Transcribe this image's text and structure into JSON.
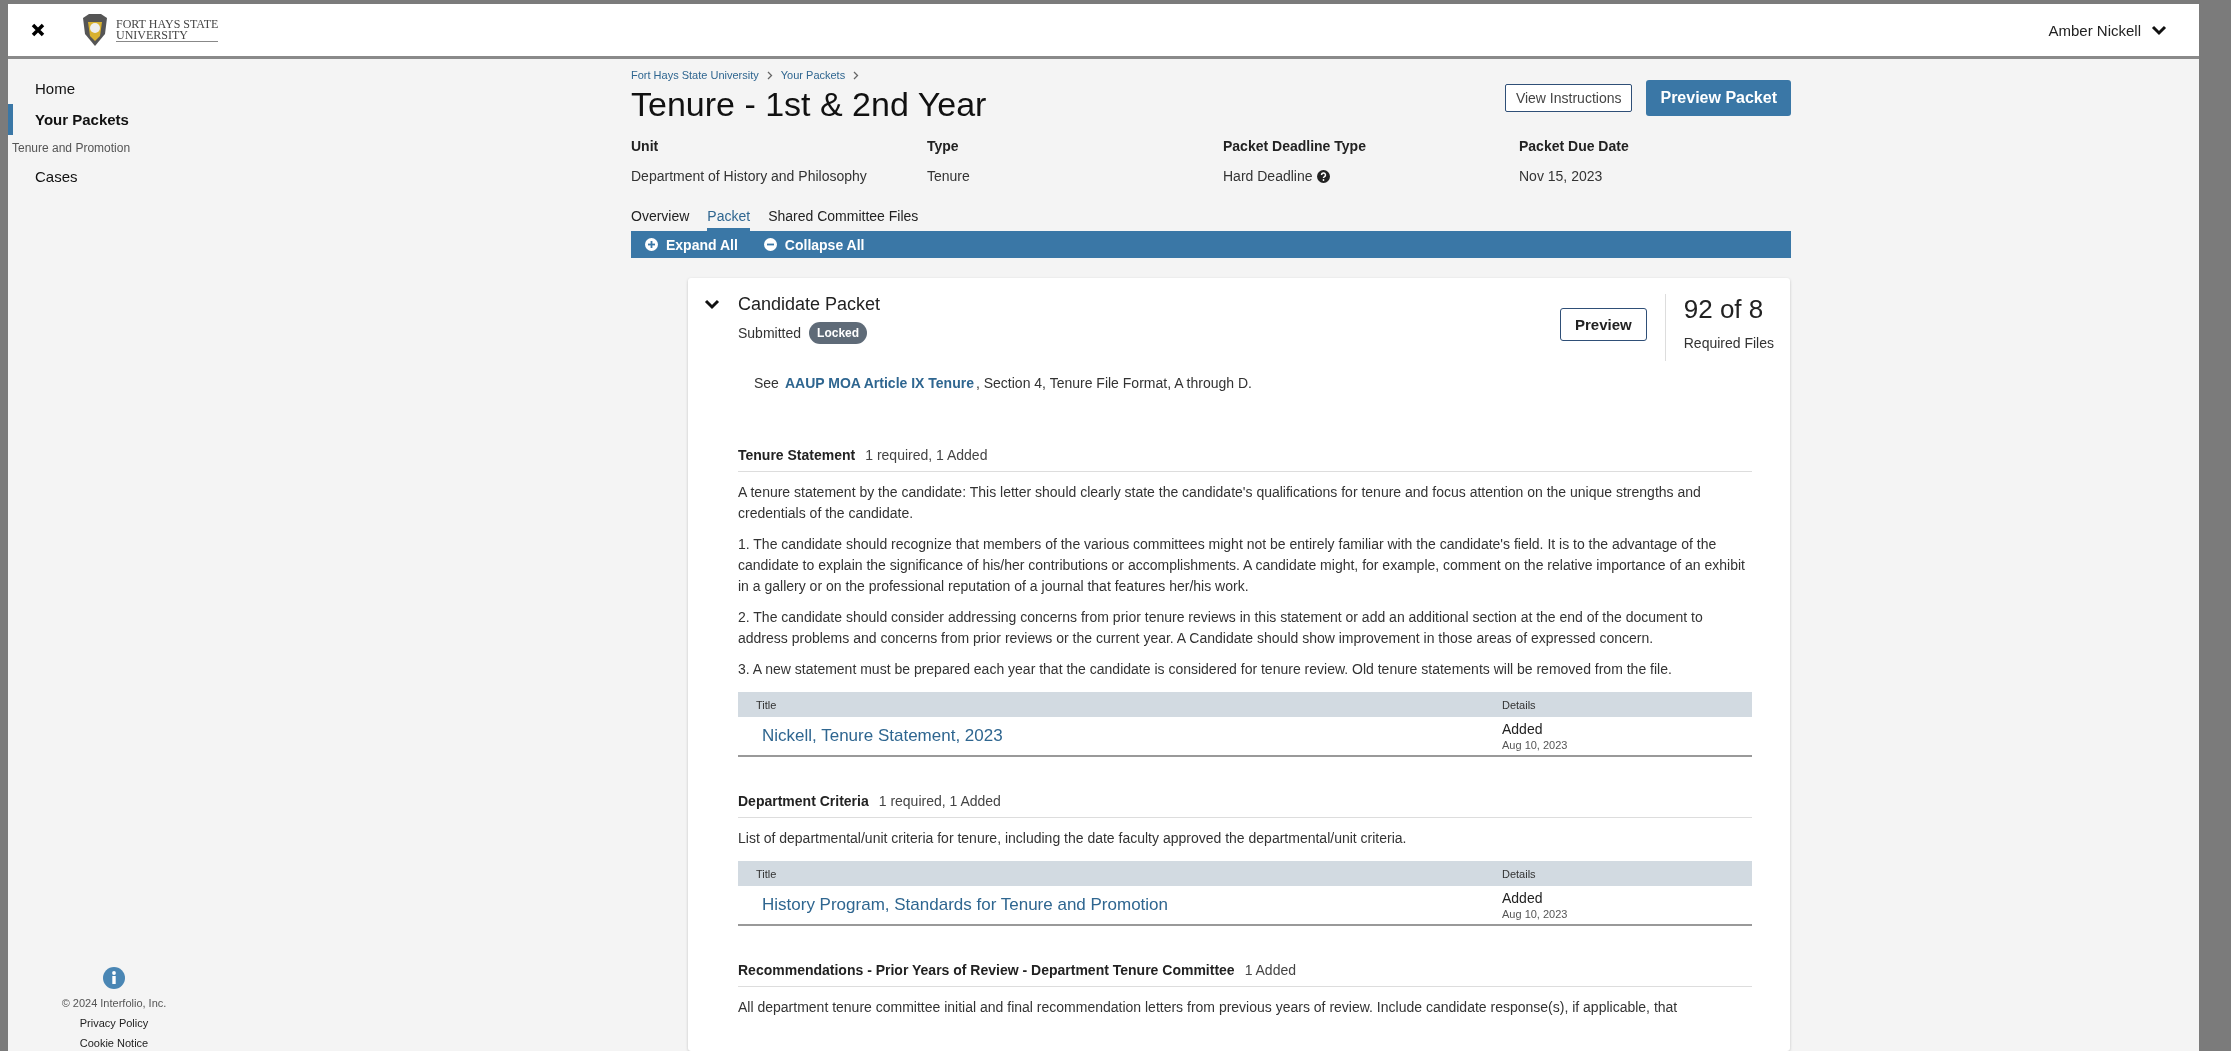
{
  "header": {
    "user_name": "Amber Nickell",
    "logo_text": [
      "FORT HAYS STATE",
      "UNIVERSITY"
    ]
  },
  "sidebar": {
    "items": [
      {
        "label": "Home",
        "kind": "link",
        "selected": false
      },
      {
        "label": "Your Packets",
        "kind": "link",
        "selected": true
      },
      {
        "label": "Tenure and Promotion",
        "kind": "section"
      },
      {
        "label": "Cases",
        "kind": "link",
        "selected": false
      }
    ],
    "footer": {
      "copyright": "© 2024 Interfolio, Inc.",
      "links": [
        "Privacy Policy",
        "Cookie Notice"
      ]
    }
  },
  "breadcrumbs": [
    "Fort Hays State University",
    "Your Packets"
  ],
  "title": "Tenure - 1st & 2nd Year",
  "actions": {
    "secondary": "View Instructions",
    "primary": "Preview Packet"
  },
  "meta": [
    {
      "label": "Unit",
      "value": "Department of History and Philosophy",
      "help": false
    },
    {
      "label": "Type",
      "value": "Tenure",
      "help": false
    },
    {
      "label": "Packet Deadline Type",
      "value": "Hard Deadline",
      "help": true
    },
    {
      "label": "Packet Due Date",
      "value": "Nov 15, 2023",
      "help": false
    }
  ],
  "tabs": [
    {
      "label": "Overview",
      "selected": false
    },
    {
      "label": "Packet",
      "selected": true
    },
    {
      "label": "Shared Committee Files",
      "selected": false
    }
  ],
  "toolbar": [
    "Expand All",
    "Collapse All"
  ],
  "packet": {
    "title": "Candidate Packet",
    "expanded": true,
    "status": "Submitted",
    "badge": "Locked",
    "preview": "Preview",
    "count": "92 of 8",
    "count_label": "Required Files",
    "note": {
      "before": "See",
      "link": "AAUP MOA Article IX Tenure",
      "after": ", Section 4, Tenure File Format, A through D."
    },
    "sections": [
      {
        "title": "Tenure Statement",
        "summary": "1 required, 1 Added",
        "paragraphs": [
          "A tenure statement by the candidate: This letter should clearly state the candidate's qualifications for tenure and focus attention on the unique strengths and credentials of the candidate.",
          "1. The candidate should recognize that members of the various committees might not be entirely familiar with the candidate's field. It is to the advantage of the candidate to explain the significance of his/her contributions or accomplishments. A candidate might, for example, comment on the relative importance of an exhibit in a gallery or on the professional reputation of a journal that features her/his work.",
          "2. The candidate should consider addressing concerns from prior tenure reviews in this statement or add an additional section at the end of the document to address problems and concerns from prior reviews or the current year. A Candidate should show improvement in those areas of expressed concern.",
          "3. A new statement must be prepared each year that the candidate is considered for tenure review. Old tenure statements will be removed from the file."
        ],
        "table": {
          "columns": [
            "Title",
            "Details"
          ],
          "rows": [
            {
              "title": "Nickell, Tenure Statement, 2023",
              "status": "Added",
              "date": "Aug 10, 2023"
            }
          ]
        }
      },
      {
        "title": "Department Criteria",
        "summary": "1 required, 1 Added",
        "paragraphs": [
          "List of departmental/unit criteria for tenure, including the date faculty approved the departmental/unit criteria."
        ],
        "table": {
          "columns": [
            "Title",
            "Details"
          ],
          "rows": [
            {
              "title": "History Program, Standards for Tenure and Promotion",
              "status": "Added",
              "date": "Aug 10, 2023"
            }
          ]
        }
      },
      {
        "title": "Recommendations - Prior Years of Review - Department Tenure Committee",
        "summary": "1 Added",
        "paragraphs": [
          "All department tenure committee initial and final recommendation letters from previous years of review.  Include candidate response(s), if applicable, that"
        ]
      }
    ]
  }
}
